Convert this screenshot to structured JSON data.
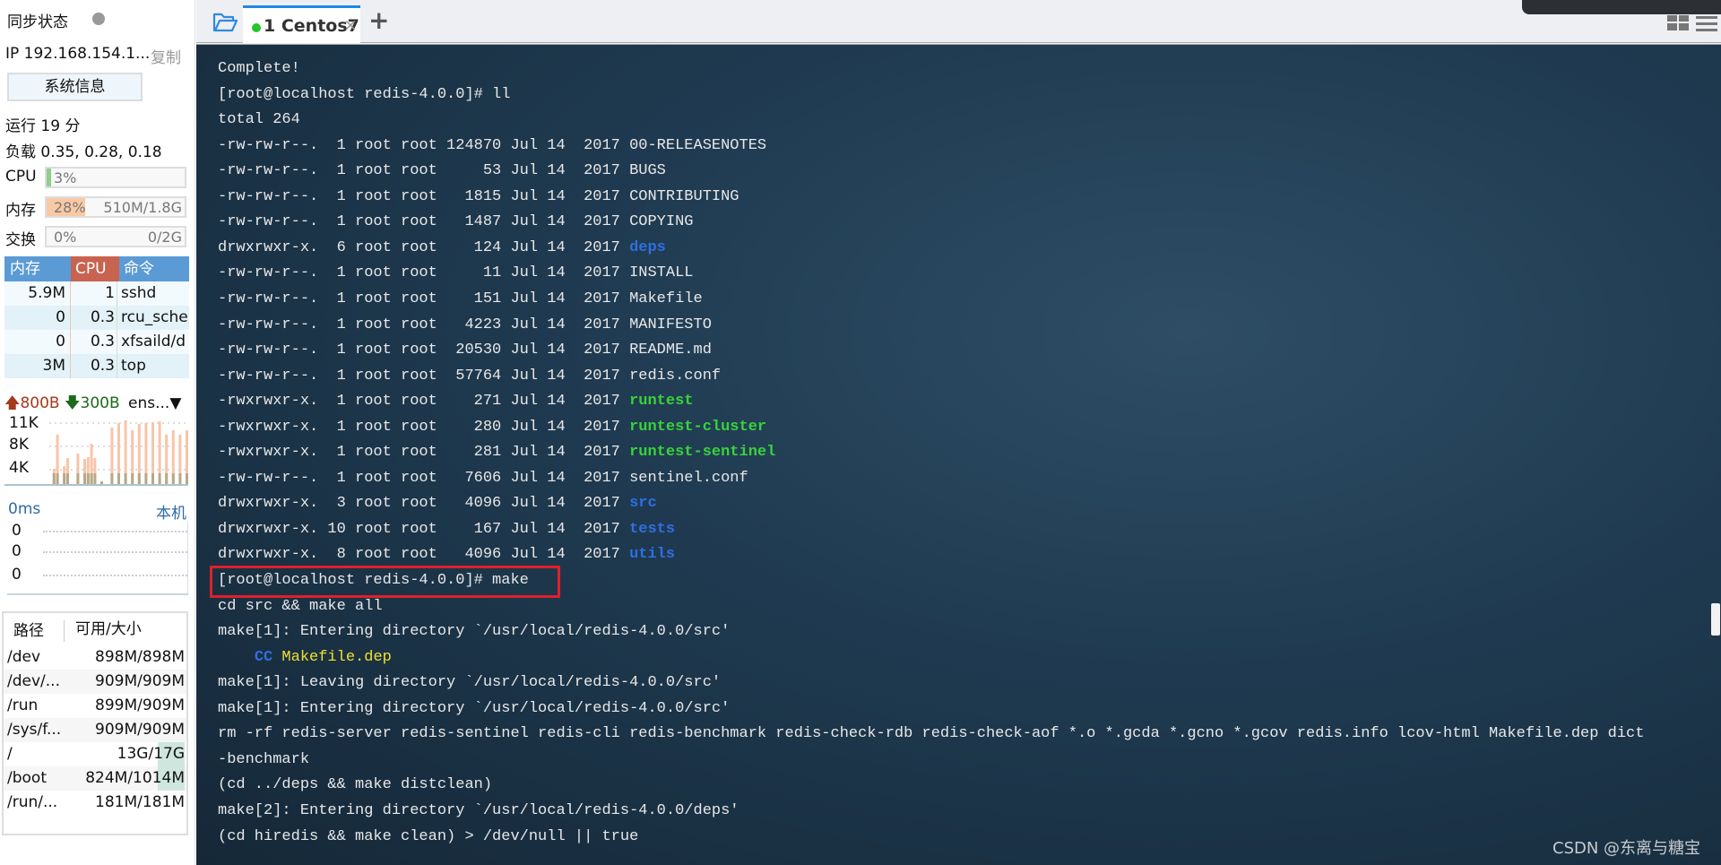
{
  "sidebar": {
    "sync_label": "同步状态",
    "ip": "IP 192.168.154.1...",
    "copy": "复制",
    "sysinfo_button": "系统信息",
    "uptime": "运行 19 分",
    "load": "负载 0.35, 0.28, 0.18",
    "cpu": {
      "label": "CPU",
      "text": "3%",
      "percent": 3
    },
    "mem": {
      "label": "内存",
      "text": "28%",
      "detail": "510M/1.8G",
      "percent": 28
    },
    "swap": {
      "label": "交换",
      "text": "0%",
      "detail": "0/2G",
      "percent": 0
    },
    "proc_headers": [
      "内存",
      "CPU",
      "命令"
    ],
    "procs": [
      {
        "mem": "5.9M",
        "cpu": "1",
        "cmd": "sshd"
      },
      {
        "mem": "0",
        "cpu": "0.3",
        "cmd": "rcu_sche"
      },
      {
        "mem": "0",
        "cpu": "0.3",
        "cmd": "xfsaild/d"
      },
      {
        "mem": "3M",
        "cpu": "0.3",
        "cmd": "top"
      }
    ],
    "net": {
      "up": "800B",
      "down": "300B",
      "iface": "ens...",
      "ticks": [
        "11K",
        "8K",
        "4K"
      ]
    },
    "latency": {
      "label": "0ms",
      "host": "本机",
      "ticks": [
        "0",
        "0",
        "0"
      ]
    },
    "disk_headers": [
      "路径",
      "可用/大小"
    ],
    "disks": [
      {
        "path": "/dev",
        "size": "898M/898M"
      },
      {
        "path": "/dev/...",
        "size": "909M/909M"
      },
      {
        "path": "/run",
        "size": "899M/909M"
      },
      {
        "path": "/sys/f...",
        "size": "909M/909M"
      },
      {
        "path": "/",
        "size": "13G/17G"
      },
      {
        "path": "/boot",
        "size": "824M/1014M"
      },
      {
        "path": "/run/...",
        "size": "181M/181M"
      }
    ]
  },
  "tabs": {
    "active": "1 Centos7",
    "add": "+",
    "close": "×"
  },
  "colors": {
    "dir": "#2f6fe0",
    "exec": "#38d33a",
    "yellow": "#f0e030",
    "highlight": "#e0202a"
  },
  "terminal": {
    "lines": [
      [
        {
          "t": "Complete!"
        }
      ],
      [
        {
          "t": "[root@localhost redis-4.0.0]# ll"
        }
      ],
      [
        {
          "t": "total 264"
        }
      ],
      [
        {
          "t": "-rw-rw-r--.  1 root root 124870 Jul 14  2017 "
        },
        {
          "t": "00-RELEASENOTES"
        }
      ],
      [
        {
          "t": "-rw-rw-r--.  1 root root     53 Jul 14  2017 "
        },
        {
          "t": "BUGS"
        }
      ],
      [
        {
          "t": "-rw-rw-r--.  1 root root   1815 Jul 14  2017 "
        },
        {
          "t": "CONTRIBUTING"
        }
      ],
      [
        {
          "t": "-rw-rw-r--.  1 root root   1487 Jul 14  2017 "
        },
        {
          "t": "COPYING"
        }
      ],
      [
        {
          "t": "drwxrwxr-x.  6 root root    124 Jul 14  2017 "
        },
        {
          "t": "deps",
          "c": "dir"
        }
      ],
      [
        {
          "t": "-rw-rw-r--.  1 root root     11 Jul 14  2017 "
        },
        {
          "t": "INSTALL"
        }
      ],
      [
        {
          "t": "-rw-rw-r--.  1 root root    151 Jul 14  2017 "
        },
        {
          "t": "Makefile"
        }
      ],
      [
        {
          "t": "-rw-rw-r--.  1 root root   4223 Jul 14  2017 "
        },
        {
          "t": "MANIFESTO"
        }
      ],
      [
        {
          "t": "-rw-rw-r--.  1 root root  20530 Jul 14  2017 "
        },
        {
          "t": "README.md"
        }
      ],
      [
        {
          "t": "-rw-rw-r--.  1 root root  57764 Jul 14  2017 "
        },
        {
          "t": "redis.conf"
        }
      ],
      [
        {
          "t": "-rwxrwxr-x.  1 root root    271 Jul 14  2017 "
        },
        {
          "t": "runtest",
          "c": "exec"
        }
      ],
      [
        {
          "t": "-rwxrwxr-x.  1 root root    280 Jul 14  2017 "
        },
        {
          "t": "runtest-cluster",
          "c": "exec"
        }
      ],
      [
        {
          "t": "-rwxrwxr-x.  1 root root    281 Jul 14  2017 "
        },
        {
          "t": "runtest-sentinel",
          "c": "exec"
        }
      ],
      [
        {
          "t": "-rw-rw-r--.  1 root root   7606 Jul 14  2017 "
        },
        {
          "t": "sentinel.conf"
        }
      ],
      [
        {
          "t": "drwxrwxr-x.  3 root root   4096 Jul 14  2017 "
        },
        {
          "t": "src",
          "c": "dir"
        }
      ],
      [
        {
          "t": "drwxrwxr-x. 10 root root    167 Jul 14  2017 "
        },
        {
          "t": "tests",
          "c": "dir"
        }
      ],
      [
        {
          "t": "drwxrwxr-x.  8 root root   4096 Jul 14  2017 "
        },
        {
          "t": "utils",
          "c": "dir"
        }
      ],
      [
        {
          "t": "[root@localhost redis-4.0.0]# make"
        }
      ],
      [
        {
          "t": "cd src && make all"
        }
      ],
      [
        {
          "t": "make[1]: Entering directory `/usr/local/redis-4.0.0/src'"
        }
      ],
      [
        {
          "t": "    "
        },
        {
          "t": "CC",
          "c": "dir"
        },
        {
          "t": " "
        },
        {
          "t": "Makefile.dep",
          "c": "yellow"
        }
      ],
      [
        {
          "t": "make[1]: Leaving directory `/usr/local/redis-4.0.0/src'"
        }
      ],
      [
        {
          "t": "make[1]: Entering directory `/usr/local/redis-4.0.0/src'"
        }
      ],
      [
        {
          "t": "rm -rf redis-server redis-sentinel redis-cli redis-benchmark redis-check-rdb redis-check-aof *.o *.gcda *.gcno *.gcov redis.info lcov-html Makefile.dep dict"
        }
      ],
      [
        {
          "t": "-benchmark"
        }
      ],
      [
        {
          "t": "(cd ../deps && make distclean)"
        }
      ],
      [
        {
          "t": "make[2]: Entering directory `/usr/local/redis-4.0.0/deps'"
        }
      ],
      [
        {
          "t": "(cd hiredis && make clean) > /dev/null || true"
        }
      ]
    ]
  },
  "watermark": "CSDN @东离与糖宝"
}
